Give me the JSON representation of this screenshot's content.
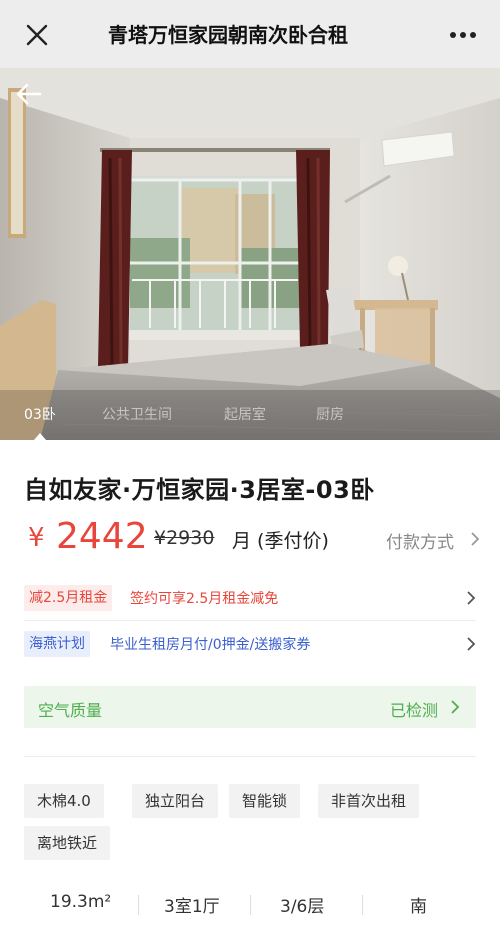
{
  "header": {
    "title": "青塔万恒家园朝南次卧合租",
    "close_icon": "close-icon",
    "more_icon": "more-icon"
  },
  "gallery": {
    "back_icon": "arrow-left-icon",
    "tabs": [
      "03卧",
      "公共卫生间",
      "起居室",
      "厨房"
    ],
    "active_tab": "03卧"
  },
  "listing": {
    "title": "自如友家·万恒家园·3居室-03卧",
    "currency": "¥",
    "price": "2442",
    "original_price": "¥2930",
    "unit": "月 (季付价)",
    "payment_link": "付款方式"
  },
  "promos": [
    {
      "tag": "减2.5月租金",
      "text": "签约可享2.5月租金减免",
      "color": "#e8463b",
      "tag_bg": "#fdecec"
    },
    {
      "tag": "海燕计划",
      "text": "毕业生租房月付/0押金/送搬家券",
      "color": "#3a5fcf",
      "tag_bg": "#e9eefc"
    }
  ],
  "air_quality": {
    "label": "空气质量",
    "status": "已检测",
    "color": "#4fae4f"
  },
  "tags": [
    "木棉4.0",
    "独立阳台",
    "智能锁",
    "非首次出租",
    "离地铁近"
  ],
  "facts": [
    "19.3m²",
    "3室1厅",
    "3/6层",
    "南"
  ]
}
